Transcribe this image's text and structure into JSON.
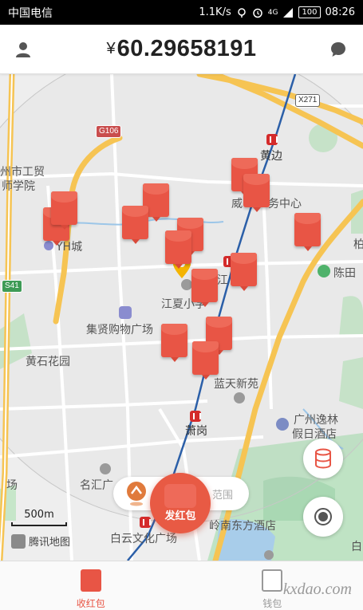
{
  "status_bar": {
    "carrier": "中国电信",
    "network_speed": "1.1K/s",
    "network_type": "4G",
    "battery": "100",
    "time": "08:26"
  },
  "header": {
    "currency_symbol": "¥",
    "balance": "60.29658191",
    "left_icon": "user-icon",
    "right_icon": "message-icon"
  },
  "map": {
    "road_tags": [
      "G106",
      "X271",
      "S41"
    ],
    "labels": {
      "huangbian": "黄边",
      "gongmao": "州市工贸",
      "shiyuan": "师学院",
      "weiling": "威",
      "wuzhongxin": "务中心",
      "yh": "YH城",
      "chentian": "陈田",
      "jiangxia_short": "江",
      "jiangxia_school": "江夏小学",
      "jixian": "集贤购物广场",
      "huangshi": "黄石花园",
      "lantian": "蓝天新苑",
      "xiaogang": "萧岗",
      "yilin": "广州逸林",
      "jiari": "假日酒店",
      "chang": "场",
      "minghui": "名汇广",
      "baiyun": "白云文化广场",
      "nanfang": "岭南东方酒店",
      "bo": "柏",
      "bai_edge": "白"
    },
    "scale": "500m",
    "attribution": "腾讯地图"
  },
  "action_bar": {
    "range_hint": "范围",
    "send_button_label": "发红包"
  },
  "bottom_nav": {
    "items": [
      {
        "label": "收红包",
        "icon": "red-packet-icon",
        "active": true
      },
      {
        "label": "钱包",
        "icon": "wallet-icon",
        "active": false
      }
    ]
  },
  "watermark": "kxdao.com",
  "colors": {
    "accent": "#e85545",
    "header_bg": "#ffffff",
    "status_bg": "#000000"
  }
}
